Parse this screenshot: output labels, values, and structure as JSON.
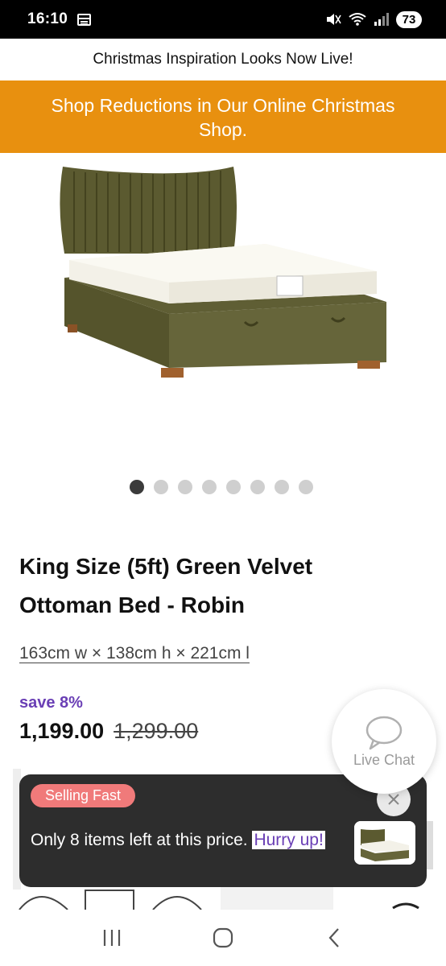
{
  "status_bar": {
    "time": "16:10",
    "battery": "73",
    "icons": [
      "calendar-icon",
      "mute-icon",
      "wifi-icon",
      "signal-icon"
    ]
  },
  "promo": {
    "top_text": "Christmas Inspiration Looks Now Live!",
    "orange_text": "Shop Reductions in Our Online Christmas Shop.",
    "orange_color": "#e8900f"
  },
  "gallery": {
    "dot_count": 8,
    "active_index": 0
  },
  "product": {
    "title": "King Size (5ft) Green Velvet Ottoman Bed - Robin",
    "dimensions": "163cm w × 138cm h × 221cm l",
    "save_label": "save 8%",
    "price_now": "1,199.00",
    "price_was": "1,299.00"
  },
  "live_chat": {
    "label": "Live Chat"
  },
  "toast": {
    "badge": "Selling Fast",
    "message": "Only 8 items left at this price.",
    "cta": "Hurry up!",
    "badge_color": "#f07a7a"
  },
  "nav": {
    "icons": [
      "recent-apps-icon",
      "home-icon",
      "back-icon"
    ]
  },
  "colors": {
    "accent_purple": "#6a3fb5",
    "bed_green": "#5b5a30"
  }
}
